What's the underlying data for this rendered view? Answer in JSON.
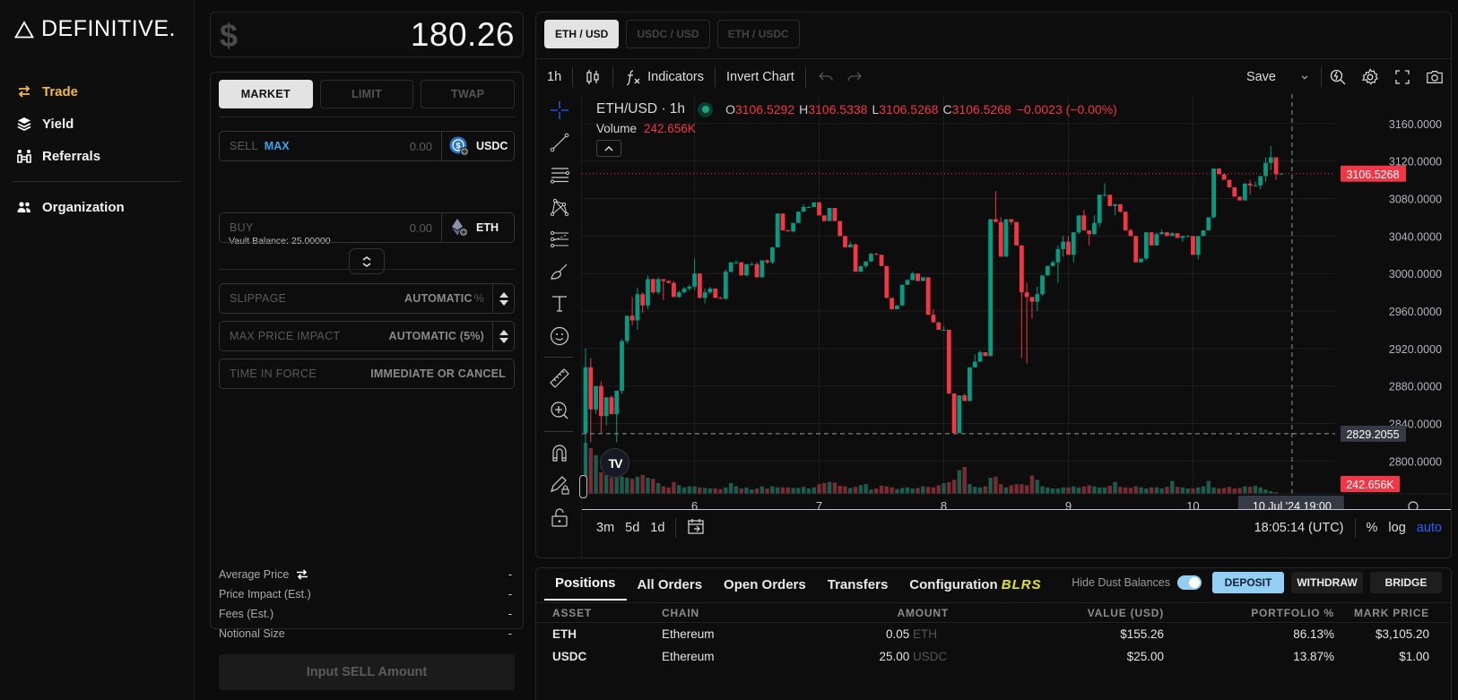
{
  "brand": {
    "name": "DEFINITIVE."
  },
  "sidebar": {
    "items": [
      {
        "label": "Trade",
        "icon": "arrows-swap-icon",
        "active": true
      },
      {
        "label": "Yield",
        "icon": "layers-icon",
        "active": false
      },
      {
        "label": "Referrals",
        "icon": "people-exchange-icon",
        "active": false
      }
    ],
    "secondary": [
      {
        "label": "Organization",
        "icon": "users-icon"
      }
    ]
  },
  "balance": {
    "currency_symbol": "$",
    "amount": "180.26"
  },
  "order": {
    "types": [
      "MARKET",
      "LIMIT",
      "TWAP"
    ],
    "active_type": "MARKET",
    "sell": {
      "label": "SELL",
      "max_label": "MAX",
      "placeholder": "0.00",
      "token": "USDC"
    },
    "vault_balance": "Vault Balance:  25.00000",
    "buy": {
      "label": "BUY",
      "placeholder": "0.00",
      "token": "ETH"
    },
    "slippage": {
      "label": "SLIPPAGE",
      "value": "AUTOMATIC",
      "suffix": "%"
    },
    "max_price_impact": {
      "label": "MAX PRICE IMPACT",
      "value": "AUTOMATIC (5%)"
    },
    "time_in_force": {
      "label": "TIME IN FORCE",
      "value": "IMMEDIATE OR CANCEL"
    },
    "stats": [
      {
        "label": "Average Price",
        "value": "-"
      },
      {
        "label": "Price Impact (Est.)",
        "value": "-"
      },
      {
        "label": "Fees (Est.)",
        "value": "-"
      },
      {
        "label": "Notional Size",
        "value": "-"
      }
    ],
    "submit_label": "Input SELL Amount"
  },
  "chart": {
    "pairs": [
      "ETH / USD",
      "USDC / USD",
      "ETH / USDC"
    ],
    "active_pair": "ETH / USD",
    "toolbar": {
      "interval": "1h",
      "indicators": "Indicators",
      "invert": "Invert Chart",
      "save": "Save"
    },
    "legend": {
      "symbol": "ETH/USD · 1h",
      "o": "3106.5292",
      "h": "3106.5338",
      "l": "3106.5268",
      "c": "3106.5268",
      "change": "−0.0023 (−0.00%)",
      "volume_label": "Volume",
      "volume": "242.656K"
    },
    "bottom": {
      "ranges": [
        "3m",
        "5d",
        "1d"
      ],
      "clock": "18:05:14 (UTC)",
      "pct": "%",
      "log": "log",
      "auto": "auto"
    },
    "colors": {
      "up": "#089981",
      "down": "#f23645",
      "vol_up": "#1d5b4f",
      "vol_down": "#7a2c33"
    }
  },
  "chart_data": {
    "type": "candlestick",
    "title": "ETH/USD · 1h",
    "xlabel": "",
    "ylabel": "",
    "x_ticks": [
      "6",
      "7",
      "8",
      "9",
      "10"
    ],
    "y_ticks": [
      "2800.0000",
      "2840.0000",
      "2880.0000",
      "2920.0000",
      "2960.0000",
      "3000.0000",
      "3040.0000",
      "3080.0000",
      "3120.0000",
      "3160.0000"
    ],
    "ylim": [
      2765,
      3185
    ],
    "start": "5 Jul '24 03:00",
    "interval_hours": 1,
    "last_price_label": "3106.5268",
    "crosshair": {
      "price_label": "2829.2055",
      "time_label": "10 Jul '24   19:00"
    },
    "volume_label": "242.656K",
    "candles": [
      [
        2830,
        2920,
        2760,
        2900
      ],
      [
        2900,
        2910,
        2820,
        2855
      ],
      [
        2855,
        2880,
        2850,
        2880
      ],
      [
        2880,
        2885,
        2830,
        2848
      ],
      [
        2848,
        2868,
        2838,
        2868
      ],
      [
        2868,
        2870,
        2850,
        2850
      ],
      [
        2850,
        2875,
        2820,
        2875
      ],
      [
        2875,
        2930,
        2872,
        2928
      ],
      [
        2928,
        2955,
        2925,
        2955
      ],
      [
        2955,
        2975,
        2945,
        2950
      ],
      [
        2950,
        2985,
        2940,
        2978
      ],
      [
        2978,
        2980,
        2958,
        2966
      ],
      [
        2966,
        2998,
        2962,
        2994
      ],
      [
        2994,
        2995,
        2978,
        2980
      ],
      [
        2980,
        2996,
        2978,
        2994
      ],
      [
        2994,
        2994,
        2972,
        2992
      ],
      [
        2992,
        2993,
        2990,
        2990
      ],
      [
        2990,
        2992,
        2976,
        2975
      ],
      [
        2975,
        2982,
        2974,
        2980
      ],
      [
        2980,
        2986,
        2979,
        2984
      ],
      [
        2984,
        2988,
        2982,
        2986
      ],
      [
        2986,
        3016,
        2982,
        3000
      ],
      [
        3000,
        3000,
        2978,
        2974
      ],
      [
        2974,
        2984,
        2968,
        2980
      ],
      [
        2980,
        2986,
        2978,
        2984
      ],
      [
        2984,
        2984,
        2974,
        2974
      ],
      [
        2974,
        2975,
        2973,
        2973
      ],
      [
        2973,
        3004,
        2972,
        3002
      ],
      [
        3002,
        3012,
        3001,
        3012
      ],
      [
        3012,
        3014,
        3010,
        3012
      ],
      [
        3012,
        3012,
        2998,
        2998
      ],
      [
        2998,
        3010,
        2997,
        3010
      ],
      [
        3010,
        3012,
        3009,
        3010
      ],
      [
        3010,
        3012,
        2996,
        2996
      ],
      [
        2996,
        3014,
        2996,
        3014
      ],
      [
        3014,
        3015,
        3010,
        3012
      ],
      [
        3012,
        3028,
        3010,
        3028
      ],
      [
        3028,
        3064,
        3028,
        3064
      ],
      [
        3064,
        3064,
        3046,
        3046
      ],
      [
        3046,
        3047,
        3045,
        3045
      ],
      [
        3045,
        3054,
        3044,
        3054
      ],
      [
        3054,
        3066,
        3054,
        3066
      ],
      [
        3066,
        3074,
        3066,
        3071
      ],
      [
        3071,
        3072,
        3071,
        3071
      ],
      [
        3071,
        3076,
        3071,
        3076
      ],
      [
        3076,
        3076,
        3064,
        3062
      ],
      [
        3062,
        3062,
        3056,
        3056
      ],
      [
        3056,
        3070,
        3056,
        3070
      ],
      [
        3070,
        3070,
        3056,
        3056
      ],
      [
        3056,
        3056,
        3040,
        3040
      ],
      [
        3040,
        3040,
        3028,
        3028
      ],
      [
        3028,
        3034,
        3028,
        3031
      ],
      [
        3031,
        3032,
        3002,
        3002
      ],
      [
        3002,
        3008,
        3002,
        3008
      ],
      [
        3008,
        3013,
        3006,
        3013
      ],
      [
        3013,
        3022,
        3012,
        3021
      ],
      [
        3021,
        3022,
        3020,
        3020
      ],
      [
        3020,
        3020,
        3008,
        3008
      ],
      [
        3008,
        3008,
        2974,
        2974
      ],
      [
        2974,
        2974,
        2962,
        2962
      ],
      [
        2962,
        2966,
        2962,
        2966
      ],
      [
        2966,
        2988,
        2966,
        2988
      ],
      [
        2988,
        2994,
        2988,
        2993
      ],
      [
        2993,
        3002,
        2993,
        3000
      ],
      [
        3000,
        3000,
        2992,
        2992
      ],
      [
        2992,
        2996,
        2992,
        2996
      ],
      [
        2996,
        2996,
        2956,
        2956
      ],
      [
        2956,
        2962,
        2948,
        2948
      ],
      [
        2948,
        2948,
        2940,
        2940
      ],
      [
        2940,
        2944,
        2940,
        2940
      ],
      [
        2940,
        2940,
        2872,
        2872
      ],
      [
        2872,
        2872,
        2830,
        2830
      ],
      [
        2830,
        2870,
        2830,
        2870
      ],
      [
        2870,
        2872,
        2865,
        2864
      ],
      [
        2864,
        2900,
        2864,
        2900
      ],
      [
        2900,
        2914,
        2900,
        2906
      ],
      [
        2906,
        2918,
        2906,
        2916
      ],
      [
        2916,
        2916,
        2912,
        2912
      ],
      [
        2912,
        3058,
        2912,
        3058
      ],
      [
        3058,
        3088,
        3055,
        3055
      ],
      [
        3055,
        3060,
        3018,
        3018
      ],
      [
        3018,
        3058,
        3018,
        3058
      ],
      [
        3058,
        3058,
        3052,
        3055
      ],
      [
        3055,
        3055,
        3030,
        3030
      ],
      [
        3030,
        3030,
        2910,
        2980
      ],
      [
        2980,
        2990,
        2904,
        2975
      ],
      [
        2975,
        2975,
        2952,
        2970
      ],
      [
        2970,
        2986,
        2960,
        2978
      ],
      [
        2978,
        2998,
        2976,
        2998
      ],
      [
        2998,
        3008,
        2998,
        3008
      ],
      [
        3008,
        3014,
        3008,
        3012
      ],
      [
        3012,
        3030,
        2990,
        3026
      ],
      [
        3026,
        3040,
        3018,
        3034
      ],
      [
        3034,
        3040,
        3025,
        3020
      ],
      [
        3020,
        3044,
        3012,
        3044
      ],
      [
        3044,
        3058,
        3042,
        3062
      ],
      [
        3062,
        3068,
        3046,
        3046
      ],
      [
        3046,
        3046,
        3030,
        3042
      ],
      [
        3042,
        3062,
        3041,
        3054
      ],
      [
        3054,
        3084,
        3050,
        3084
      ],
      [
        3084,
        3096,
        3082,
        3084
      ],
      [
        3084,
        3084,
        3072,
        3072
      ],
      [
        3072,
        3074,
        3062,
        3074
      ],
      [
        3074,
        3074,
        3065,
        3066
      ],
      [
        3066,
        3066,
        3046,
        3046
      ],
      [
        3046,
        3048,
        3040,
        3040
      ],
      [
        3040,
        3040,
        3012,
        3012
      ],
      [
        3012,
        3016,
        3012,
        3016
      ],
      [
        3016,
        3044,
        3014,
        3044
      ],
      [
        3044,
        3044,
        3030,
        3030
      ],
      [
        3030,
        3044,
        3030,
        3042
      ],
      [
        3042,
        3047,
        3042,
        3044
      ],
      [
        3044,
        3044,
        3040,
        3040
      ],
      [
        3040,
        3044,
        3040,
        3043
      ],
      [
        3043,
        3043,
        3038,
        3038
      ],
      [
        3038,
        3040,
        3034,
        3040
      ],
      [
        3040,
        3041,
        3040,
        3040
      ],
      [
        3040,
        3040,
        3020,
        3020
      ],
      [
        3020,
        3040,
        3015,
        3040
      ],
      [
        3040,
        3046,
        3040,
        3046
      ],
      [
        3046,
        3060,
        3046,
        3060
      ],
      [
        3060,
        3112,
        3059,
        3112
      ],
      [
        3112,
        3112,
        3106,
        3106
      ],
      [
        3106,
        3106,
        3100,
        3100
      ],
      [
        3100,
        3100,
        3096,
        3092
      ],
      [
        3092,
        3092,
        3082,
        3082
      ],
      [
        3082,
        3082,
        3078,
        3078
      ],
      [
        3078,
        3096,
        3078,
        3096
      ],
      [
        3096,
        3100,
        3084,
        3094
      ],
      [
        3094,
        3098,
        3094,
        3094
      ],
      [
        3094,
        3104,
        3090,
        3104
      ],
      [
        3104,
        3124,
        3098,
        3118
      ],
      [
        3118,
        3136,
        3110,
        3124
      ],
      [
        3124,
        3124,
        3100,
        3106
      ],
      [
        3106,
        3107,
        3106,
        3106.5
      ]
    ],
    "volumes": [
      0.95,
      0.85,
      0.72,
      0.4,
      0.35,
      0.3,
      0.3,
      0.32,
      0.3,
      0.28,
      0.32,
      0.35,
      0.3,
      0.28,
      0.2,
      0.14,
      0.12,
      0.22,
      0.16,
      0.12,
      0.14,
      0.14,
      0.12,
      0.11,
      0.1,
      0.1,
      0.09,
      0.12,
      0.2,
      0.14,
      0.1,
      0.12,
      0.08,
      0.1,
      0.14,
      0.1,
      0.14,
      0.12,
      0.12,
      0.12,
      0.11,
      0.11,
      0.13,
      0.1,
      0.12,
      0.18,
      0.2,
      0.22,
      0.21,
      0.15,
      0.14,
      0.11,
      0.13,
      0.16,
      0.18,
      0.08,
      0.1,
      0.15,
      0.14,
      0.12,
      0.09,
      0.11,
      0.12,
      0.1,
      0.11,
      0.14,
      0.13,
      0.12,
      0.16,
      0.2,
      0.22,
      0.26,
      0.44,
      0.5,
      0.18,
      0.13,
      0.12,
      0.14,
      0.3,
      0.32,
      0.18,
      0.12,
      0.16,
      0.18,
      0.18,
      0.16,
      0.34,
      0.26,
      0.14,
      0.12,
      0.1,
      0.1,
      0.12,
      0.12,
      0.14,
      0.12,
      0.14,
      0.16,
      0.14,
      0.12,
      0.12,
      0.15,
      0.22,
      0.13,
      0.12,
      0.11,
      0.14,
      0.12,
      0.1,
      0.12,
      0.12,
      0.1,
      0.13,
      0.24,
      0.13,
      0.12,
      0.1,
      0.1,
      0.12,
      0.14,
      0.24,
      0.12,
      0.1,
      0.11,
      0.13,
      0.1,
      0.11,
      0.14,
      0.13,
      0.15,
      0.12,
      0.08,
      0.05,
      0.03
    ]
  },
  "positions": {
    "tabs": [
      "Positions",
      "All Orders",
      "Open Orders",
      "Transfers",
      "Configuration"
    ],
    "active_tab": "Positions",
    "badge": "BLRS",
    "hide_dust_label": "Hide Dust Balances",
    "hide_dust_on": true,
    "buttons": {
      "deposit": "DEPOSIT",
      "withdraw": "WITHDRAW",
      "bridge": "BRIDGE"
    },
    "columns": [
      "ASSET",
      "CHAIN",
      "AMOUNT",
      "VALUE (USD)",
      "PORTFOLIO %",
      "MARK PRICE"
    ],
    "rows": [
      {
        "asset": "ETH",
        "chain": "Ethereum",
        "amount": "0.05",
        "unit": "ETH",
        "value": "$155.26",
        "portfolio": "86.13%",
        "mark": "$3,105.20"
      },
      {
        "asset": "USDC",
        "chain": "Ethereum",
        "amount": "25.00",
        "unit": "USDC",
        "value": "$25.00",
        "portfolio": "13.87%",
        "mark": "$1.00"
      }
    ]
  }
}
